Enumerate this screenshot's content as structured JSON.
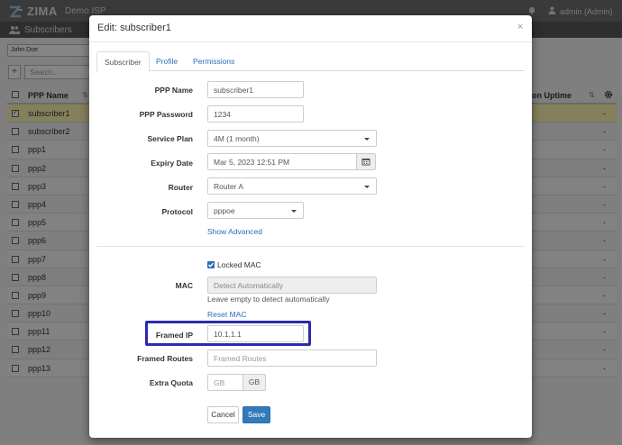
{
  "app": {
    "brand": "ZIMA",
    "org": "Demo ISP",
    "user": "admin (Admin)",
    "page_title": "Subscribers",
    "customer": "John Doe",
    "add_label": "+",
    "search_placeholder": "Search..."
  },
  "table": {
    "col_name": "PPP Name",
    "col_uptime": "on Uptime",
    "rows": [
      {
        "name": "subscriber1",
        "value": "-"
      },
      {
        "name": "subscriber2",
        "value": "-"
      },
      {
        "name": "ppp1",
        "value": "-"
      },
      {
        "name": "ppp2",
        "value": "-"
      },
      {
        "name": "ppp3",
        "value": "-"
      },
      {
        "name": "ppp4",
        "value": "-"
      },
      {
        "name": "ppp5",
        "value": "-"
      },
      {
        "name": "ppp6",
        "value": "-"
      },
      {
        "name": "ppp7",
        "value": "-"
      },
      {
        "name": "ppp8",
        "value": "-"
      },
      {
        "name": "ppp9",
        "value": "-"
      },
      {
        "name": "ppp10",
        "value": "-"
      },
      {
        "name": "ppp11",
        "value": "-"
      },
      {
        "name": "ppp12",
        "value": "-"
      },
      {
        "name": "ppp13",
        "value": "-"
      }
    ]
  },
  "modal": {
    "title": "Edit: subscriber1",
    "close": "×",
    "tabs": [
      "Subscriber",
      "Profile",
      "Permissions"
    ],
    "fields": {
      "ppp_name": {
        "label": "PPP Name",
        "value": "subscriber1"
      },
      "ppp_password": {
        "label": "PPP Password",
        "value": "1234"
      },
      "service_plan": {
        "label": "Service Plan",
        "value": "4M (1 month)"
      },
      "expiry_date": {
        "label": "Expiry Date",
        "value": "Mar 5, 2023 12:51 PM"
      },
      "router": {
        "label": "Router",
        "value": "Router A"
      },
      "protocol": {
        "label": "Protocol",
        "value": "pppoe"
      },
      "show_advanced": "Show Advanced",
      "locked_mac": "Locked MAC",
      "mac": {
        "label": "MAC",
        "placeholder": "Detect Automatically",
        "help": "Leave empty to detect automatically"
      },
      "reset_mac": "Reset MAC",
      "framed_ip": {
        "label": "Framed IP",
        "value": "10.1.1.1"
      },
      "framed_routes": {
        "label": "Framed Routes",
        "placeholder": "Framed Routes"
      },
      "extra_quota": {
        "label": "Extra Quota",
        "placeholder": "GB",
        "unit": "GB"
      }
    },
    "buttons": {
      "cancel": "Cancel",
      "save": "Save"
    }
  },
  "colors": {
    "accent": "#337ab7",
    "link": "#2a6ebb",
    "highlight_box": "#2b2bb0",
    "selected_row": "#fff6b0"
  }
}
